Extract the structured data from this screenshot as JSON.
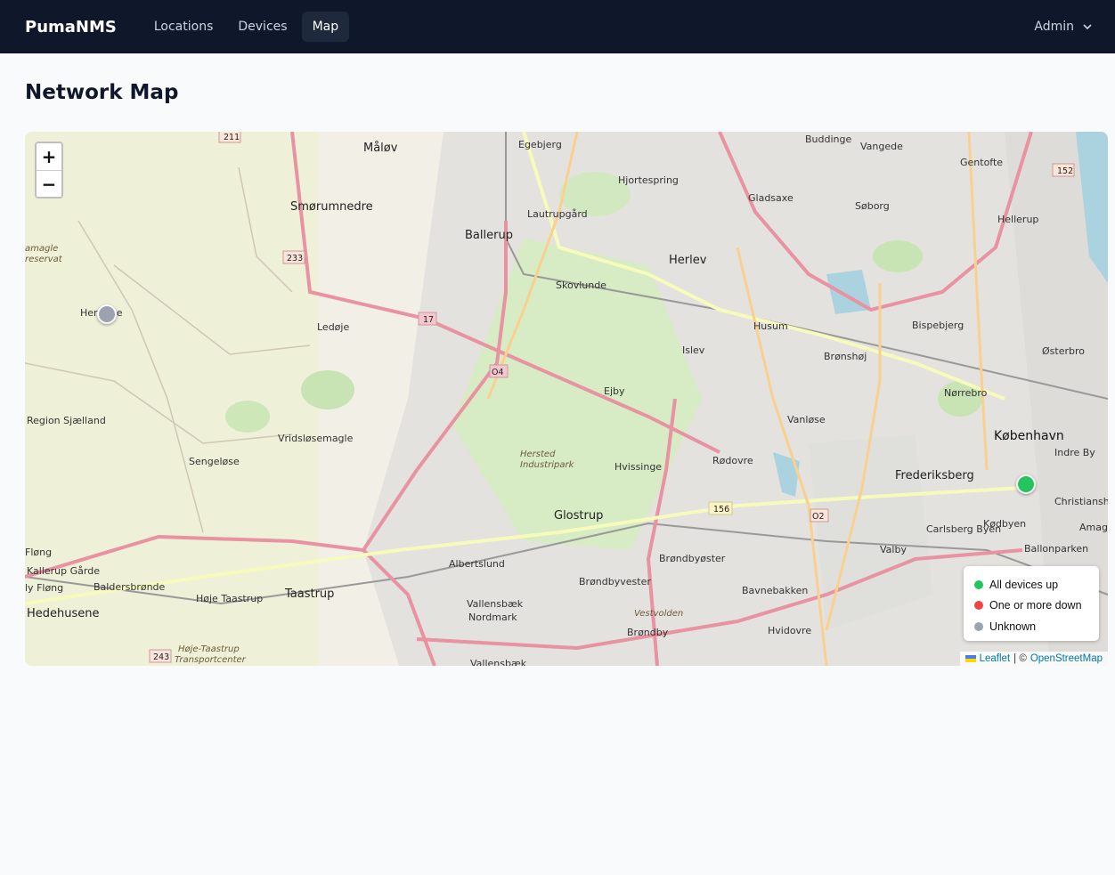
{
  "nav": {
    "brand": "PumaNMS",
    "links": [
      {
        "label": "Locations",
        "active": false
      },
      {
        "label": "Devices",
        "active": false
      },
      {
        "label": "Map",
        "active": true
      }
    ],
    "user": "Admin"
  },
  "page": {
    "title": "Network Map"
  },
  "map": {
    "zoom_in": "+",
    "zoom_out": "−",
    "places": [
      "Måløv",
      "Egebjerg",
      "Buddinge",
      "Vangede",
      "Gentofte",
      "Hjortespring",
      "Gladsaxe",
      "Søborg",
      "Hellerup",
      "Smørumnedre",
      "Lautrupgård",
      "Ballerup",
      "Herlev",
      "Skovlunde",
      "Hersløse",
      "Ledøje",
      "Husum",
      "Bispebjerg",
      "Islev",
      "Brønshøj",
      "Østerbro",
      "Ejby",
      "Nørrebro",
      "Vanløse",
      "København",
      "Indre By",
      "Rødovre",
      "Hvissinge",
      "Frederiksberg",
      "Christianshavn",
      "Vridsløsemagle",
      "Sengeløse",
      "Glostrup",
      "Kødbyen",
      "Carlsberg Byen",
      "Valby",
      "Amager",
      "Flong",
      "Kallerup Gårde",
      "Albertslund",
      "Brøndbyøster",
      "Ballonparken",
      "Baldersbrønde",
      "Taastrup",
      "Høje Taastrup",
      "Brøndbyvester",
      "Vallensbæk Nordmark",
      "Bavnebakken",
      "Hedehusene",
      "Brøndby",
      "Hvidovre",
      "Region Sjælland",
      "Herlev",
      "Vallensbæk"
    ],
    "route_shields": [
      "211",
      "152",
      "233",
      "17",
      "O4",
      "156",
      "O2",
      "243"
    ],
    "italic_labels": [
      "Hersted Industripark",
      "Høje-Taastrup Transportcenter",
      "Vestvolden",
      "Amagle reservat"
    ],
    "markers": [
      {
        "name": "Hersløse site",
        "status": "unknown",
        "color": "#9ca3af"
      },
      {
        "name": "København site",
        "status": "up",
        "color": "#22c55e"
      }
    ],
    "legend": [
      {
        "label": "All devices up",
        "color": "#22c55e"
      },
      {
        "label": "One or more down",
        "color": "#ef4444"
      },
      {
        "label": "Unknown",
        "color": "#9ca3af"
      }
    ],
    "attribution": {
      "leaflet": "Leaflet",
      "separator": "| ©",
      "osm": "OpenStreetMap"
    }
  }
}
